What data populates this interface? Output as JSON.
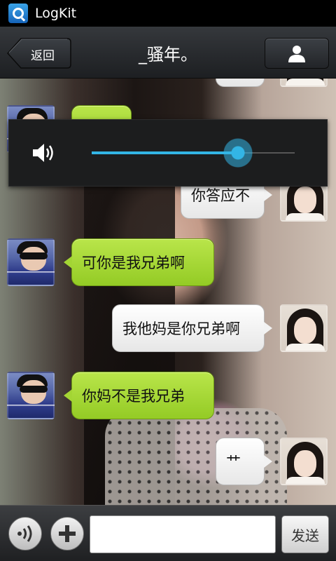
{
  "statusbar": {
    "app_name": "LogKit",
    "app_icon": "logkit-icon"
  },
  "header": {
    "back_label": "返回",
    "title": "_骚年。",
    "profile_icon": "person-icon"
  },
  "messages": [
    {
      "side": "right",
      "text": "",
      "note": "partially hidden bubble at top"
    },
    {
      "side": "left",
      "text": "",
      "note": "bubble hidden under volume panel"
    },
    {
      "side": "right",
      "text": "你答应不"
    },
    {
      "side": "left",
      "text": "可你是我兄弟啊"
    },
    {
      "side": "right",
      "text": "我他妈是你兄弟啊"
    },
    {
      "side": "left",
      "text": "你妈不是我兄弟"
    },
    {
      "side": "right",
      "text": "艹"
    }
  ],
  "volume": {
    "level": 0.72,
    "icon": "speaker-icon",
    "accent": "#33b5e5"
  },
  "inputbar": {
    "voice_icon": "voice-icon",
    "add_icon": "plus-icon",
    "input_value": "",
    "send_label": "发送"
  },
  "colors": {
    "green_bubble": "#a3d534",
    "white_bubble": "#f2f2f2",
    "header_bg": "#2a2c2f"
  }
}
